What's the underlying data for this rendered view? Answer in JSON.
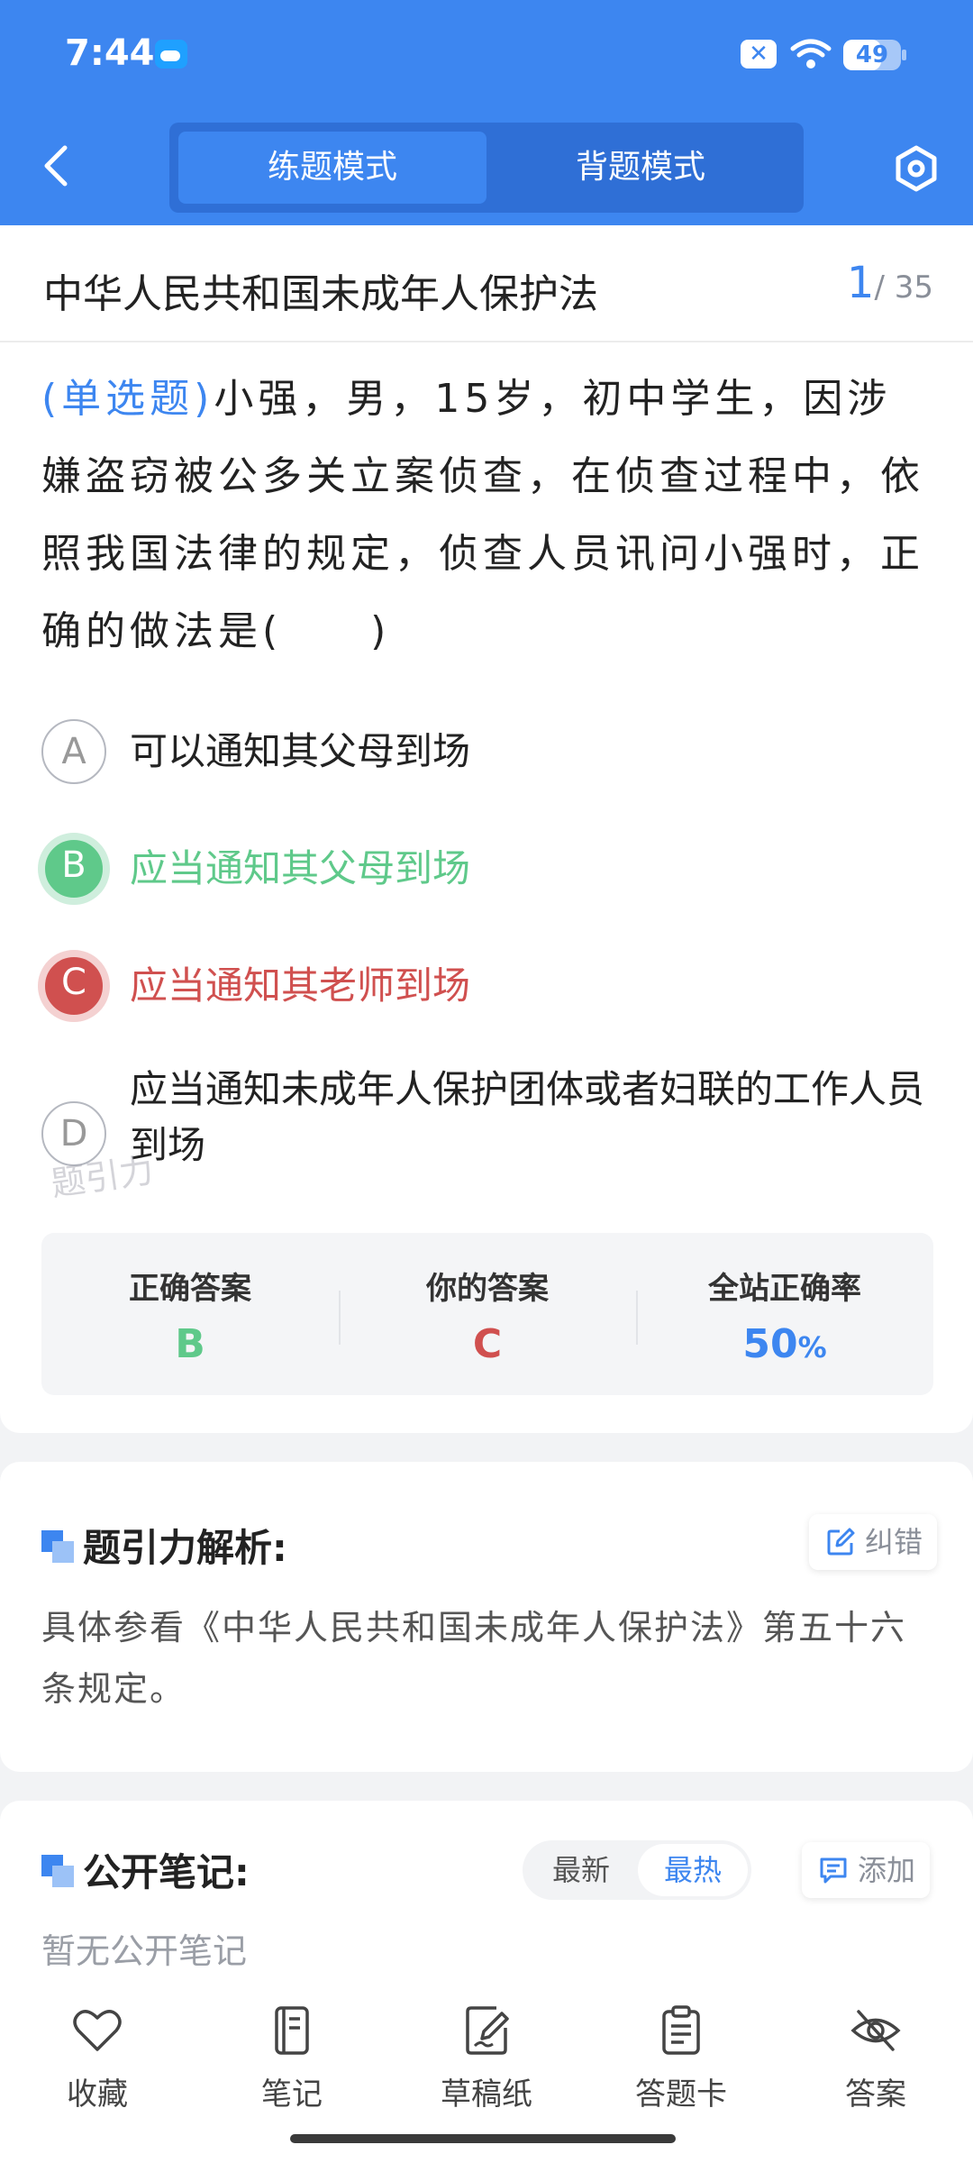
{
  "status": {
    "time": "7:44",
    "battery": "49"
  },
  "header": {
    "mode_practice": "练题模式",
    "mode_recite": "背题模式"
  },
  "question": {
    "law_title": "中华人民共和国未成年人保护法",
    "index": "1",
    "total": "/ 35",
    "type": "(单选题)",
    "text": "小强，男，15岁，初中学生，因涉嫌盗窃被公多关立案侦查，在侦查过程中，依照我国法律的规定，侦查人员讯问小强时，正确的做法是(　　)",
    "options": [
      {
        "letter": "A",
        "text": "可以通知其父母到场",
        "state": "normal"
      },
      {
        "letter": "B",
        "text": "应当通知其父母到场",
        "state": "correct"
      },
      {
        "letter": "C",
        "text": "应当通知其老师到场",
        "state": "wrong"
      },
      {
        "letter": "D",
        "text": "应当通知未成年人保护团体或者妇联的工作人员到场",
        "state": "normal"
      }
    ],
    "watermark": "题引力"
  },
  "answers": {
    "correct_label": "正确答案",
    "correct_value": "B",
    "yours_label": "你的答案",
    "yours_value": "C",
    "rate_label": "全站正确率",
    "rate_value": "50",
    "rate_unit": "%"
  },
  "analysis": {
    "title": "题引力解析:",
    "report_label": "纠错",
    "text": "具体参看《中华人民共和国未成年人保护法》第五十六条规定。"
  },
  "notes": {
    "title": "公开笔记:",
    "sort_newest": "最新",
    "sort_hottest": "最热",
    "add_label": "添加",
    "empty_text": "暂无公开笔记"
  },
  "bottom_nav": [
    {
      "label": "收藏",
      "icon": "heart-icon"
    },
    {
      "label": "笔记",
      "icon": "notebook-icon"
    },
    {
      "label": "草稿纸",
      "icon": "draft-icon"
    },
    {
      "label": "答题卡",
      "icon": "answer-card-icon"
    },
    {
      "label": "答案",
      "icon": "eye-off-icon"
    }
  ],
  "colors": {
    "primary": "#3d86f0",
    "correct": "#5fc98a",
    "wrong": "#d0504f"
  }
}
